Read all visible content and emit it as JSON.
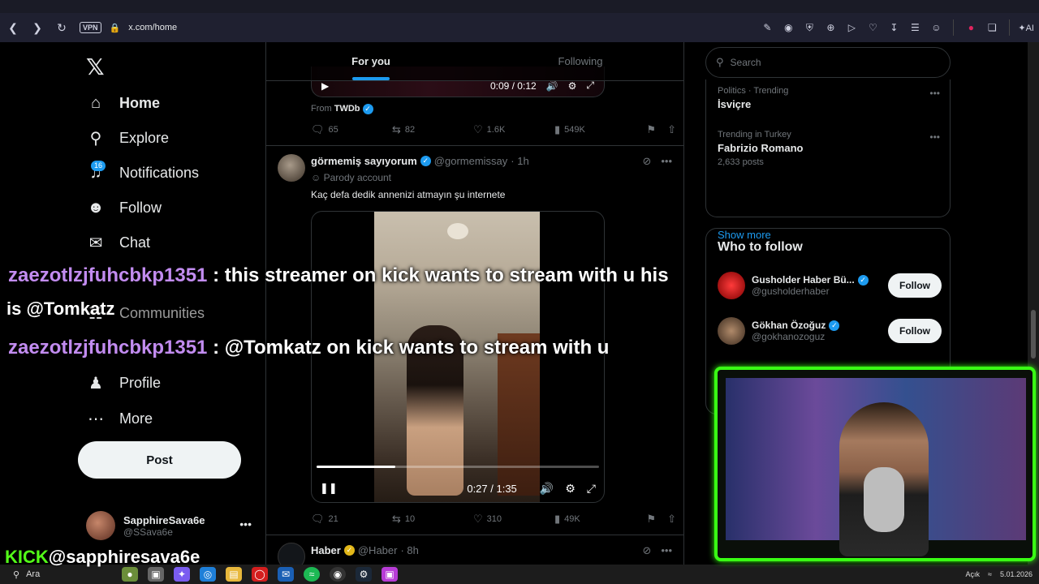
{
  "browser": {
    "back_icon": "back-arrow-icon",
    "vpn_label": "VPN",
    "url": "x.com/home",
    "ai_label": "AI"
  },
  "nav": {
    "items": [
      {
        "label": "Home",
        "icon": "home-icon"
      },
      {
        "label": "Explore",
        "icon": "search-icon"
      },
      {
        "label": "Notifications",
        "icon": "bell-icon",
        "badge": "16"
      },
      {
        "label": "Follow",
        "icon": "person-add-icon"
      },
      {
        "label": "Chat",
        "icon": "mail-icon"
      },
      {
        "label": "Communities",
        "icon": "people-icon"
      },
      {
        "label": "Profile",
        "icon": "person-icon"
      },
      {
        "label": "More",
        "icon": "more-circle-icon"
      }
    ],
    "post_label": "Post",
    "account": {
      "name": "SapphireSava6e",
      "handle": "@SSava6e"
    }
  },
  "timeline": {
    "tabs": [
      {
        "label": "For you",
        "active": true
      },
      {
        "label": "Following",
        "active": false
      }
    ],
    "prev_video_time": "0:09 / 0:12",
    "from_prefix": "From",
    "from_source": "TWDb",
    "prev_actions": {
      "replies": "65",
      "reposts": "82",
      "likes": "1.6K",
      "views": "549K"
    },
    "tweet": {
      "name": "görmemiş sayıyorum",
      "handle": "@gormemissay",
      "time": "· 1h",
      "parody": "Parody account",
      "text": "Kaç defa dedik annenizi atmayın şu internete",
      "video_time": "0:27 / 1:35",
      "progress": 0.28,
      "actions": {
        "replies": "21",
        "reposts": "10",
        "likes": "310",
        "views": "49K"
      }
    },
    "next_tweet": {
      "name": "Haber",
      "handle": "@Haber",
      "time": "· 8h"
    }
  },
  "right": {
    "search_placeholder": "Search",
    "trends": [
      {
        "context": "Politics · Trending",
        "title": "İsviçre",
        "count": ""
      },
      {
        "context": "Trending in Turkey",
        "title": "Fabrizio Romano",
        "count": "2,633 posts"
      }
    ],
    "show_more": "Show more",
    "who_to_follow": "Who to follow",
    "suggestions": [
      {
        "name": "Gusholder Haber Bü...",
        "handle": "@gusholderhaber",
        "button": "Follow"
      },
      {
        "name": "Gökhan Özoğuz",
        "handle": "@gokhanozoguz",
        "button": "Follow"
      }
    ]
  },
  "overlay": {
    "chat": [
      {
        "user": "zaezotlzjfuhcbkp1351",
        "sep": " : ",
        "message": "this streamer on kick wants to stream with u his"
      },
      {
        "user": "zaezotlzjfuhcbkp1351",
        "sep": " : ",
        "message": "@Tomkatz on kick wants to stream with u"
      }
    ],
    "chat_continuation": "is @Tomkatz",
    "kick_logo": "KICK",
    "kick_handle": "@sapphiresava6e"
  },
  "taskbar": {
    "search_label": "Ara",
    "clock_label": "Açık",
    "date": "5.01.2026"
  }
}
